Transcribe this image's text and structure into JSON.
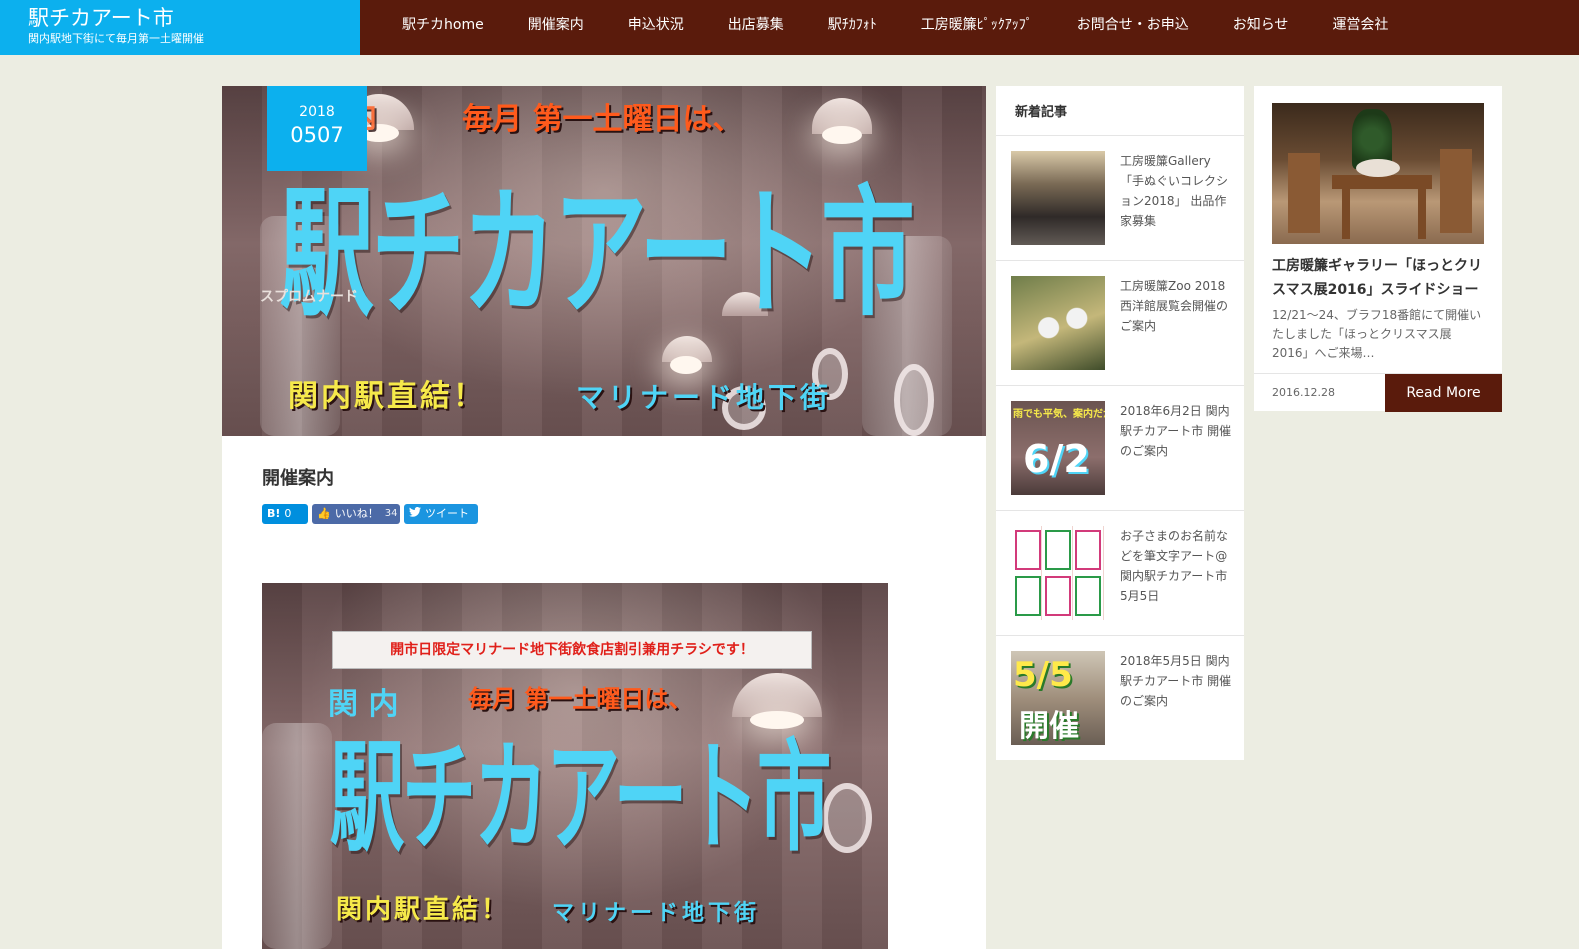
{
  "site": {
    "title": "駅チカアート市",
    "subtitle": "関内駅地下街にて毎月第一土曜開催"
  },
  "nav": [
    "駅チカhome",
    "開催案内",
    "申込状況",
    "出店募集",
    "駅ﾁｶﾌｫﾄ",
    "工房暖簾ﾋﾟｯｸｱｯﾌﾟ",
    "お問合せ・お申込",
    "お知らせ",
    "運営会社"
  ],
  "article": {
    "date_year": "2018",
    "date_md": "0507",
    "title": "開催案内",
    "share": {
      "hatena_icon": "B!",
      "hatena_count": "0",
      "like_label": "いいね！",
      "like_count": "34",
      "tweet_label": "ツイート"
    },
    "hero_poster": {
      "kannai": "関内",
      "line1": "毎月 第一土曜日は、",
      "big": "駅チカアート市",
      "yellow": "関内駅直結！",
      "cyan": "マリナード地下街"
    },
    "body_poster": {
      "banner": "開市日限定マリナード地下街飲食店割引兼用チラシです！",
      "kannai": "関 内",
      "line1": "毎月 第一土曜日は、",
      "big": "駅チカアート市",
      "yellow": "関内駅直結！",
      "cyan": "マリナード地下街"
    }
  },
  "sidebar_new": {
    "heading": "新着記事",
    "posts": [
      {
        "text": "工房暖簾Gallery「手ぬぐいコレクション2018」 出品作家募集",
        "thumb_label": ""
      },
      {
        "text": "工房暖簾Zoo 2018　西洋館展覧会開催のご案内",
        "thumb_label": ""
      },
      {
        "text": "2018年6月2日 関内駅チカアート市 開催のご案内",
        "thumb_label": "6/2",
        "thumb_top": "雨でも平気、案内だか"
      },
      {
        "text": "お子さまのお名前などを筆文字アート@関内駅チカアート市5月5日",
        "thumb_label": ""
      },
      {
        "text": "2018年5月5日 関内駅チカアート市 開催のご案内",
        "thumb_label": "5/5",
        "thumb_label2": "開催"
      }
    ]
  },
  "feature": {
    "title": "工房暖簾ギャラリー「ほっとクリスマス展2016」スライドショー",
    "excerpt": "12/21～24、ブラフ18番館にて開催いたしました「ほっとクリスマス展2016」へご来場…",
    "date": "2016.12.28",
    "read_more": "Read More"
  },
  "colors": {
    "brand_blue": "#0cb0ee",
    "header_brown": "#5a1b0c",
    "page_bg": "#ecede2",
    "poster_cyan": "#4fd4f6",
    "poster_orange": "#ff5a1c",
    "poster_yellow": "#f6e94a"
  }
}
